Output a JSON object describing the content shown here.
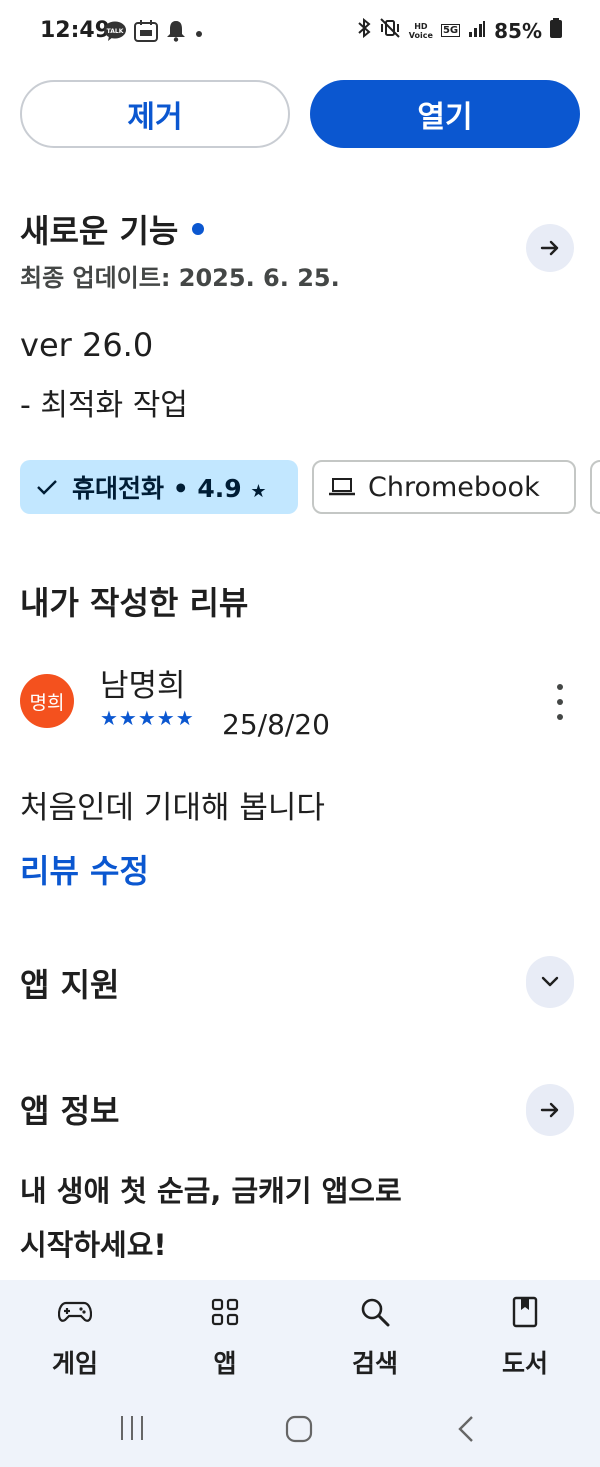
{
  "status_bar": {
    "time": "12:49",
    "battery": "85%",
    "left_icons": [
      "talk-icon",
      "calendar-notification-icon",
      "bell-icon",
      "dot-icon"
    ],
    "right_icons": [
      "bluetooth-icon",
      "vibrate-mute-icon",
      "hd-voice-icon",
      "5g-icon",
      "signal-icon",
      "battery-icon"
    ],
    "hd_voice_text": "HD\nVoice",
    "network_text": "5G"
  },
  "actions": {
    "remove_label": "제거",
    "open_label": "열기"
  },
  "whats_new": {
    "title": "새로운 기능",
    "last_updated": "최종 업데이트: 2025. 6. 25.",
    "version_line": "ver 26.0",
    "note_line": "- 최적화 작업"
  },
  "device_chips": {
    "phone_label": "휴대전화 • 4.9",
    "phone_star": "★",
    "chromebook_label": "Chromebook"
  },
  "my_review": {
    "section_title": "내가 작성한 리뷰",
    "avatar_text": "명희",
    "reviewer_name": "남명희",
    "rating": 5,
    "stars": "★★★★★",
    "date": "25/8/20",
    "text": "처음인데 기대해 봅니다",
    "edit_label": "리뷰 수정"
  },
  "app_support": {
    "title": "앱 지원"
  },
  "app_info": {
    "title": "앱 정보",
    "description_line1": "내 생애 첫 순금, 금캐기 앱으로",
    "description_line2": "시작하세요!"
  },
  "bottom_nav": {
    "items": [
      {
        "label": "게임",
        "icon": "gamepad-icon"
      },
      {
        "label": "앱",
        "icon": "apps-grid-icon"
      },
      {
        "label": "검색",
        "icon": "search-icon"
      },
      {
        "label": "도서",
        "icon": "book-icon"
      }
    ]
  },
  "colors": {
    "accent": "#0b57d0",
    "chip_selected_bg": "#c2e7ff",
    "avatar_bg": "#f4511e",
    "nav_bg": "#eff3fa"
  }
}
